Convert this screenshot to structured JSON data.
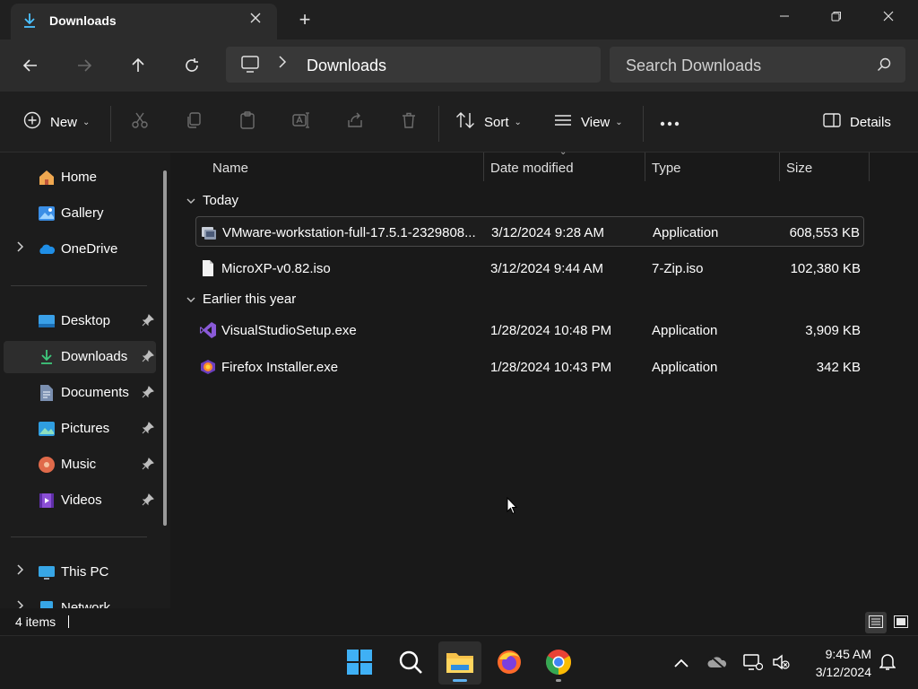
{
  "window": {
    "tab_title": "Downloads",
    "new_tab_symbol": "+"
  },
  "navbar": {
    "breadcrumb": [
      "Downloads"
    ],
    "search_placeholder": "Search Downloads"
  },
  "commandbar": {
    "new_label": "New",
    "sort_label": "Sort",
    "view_label": "View",
    "details_label": "Details"
  },
  "sidebar": {
    "items": [
      {
        "label": "Home",
        "icon": "home-icon"
      },
      {
        "label": "Gallery",
        "icon": "gallery-icon"
      },
      {
        "label": "OneDrive",
        "icon": "onedrive-icon"
      },
      {
        "label": "Desktop",
        "icon": "desktop-icon",
        "pinned": true
      },
      {
        "label": "Downloads",
        "icon": "downloads-icon",
        "pinned": true,
        "active": true
      },
      {
        "label": "Documents",
        "icon": "documents-icon",
        "pinned": true
      },
      {
        "label": "Pictures",
        "icon": "pictures-icon",
        "pinned": true
      },
      {
        "label": "Music",
        "icon": "music-icon",
        "pinned": true
      },
      {
        "label": "Videos",
        "icon": "videos-icon",
        "pinned": true
      },
      {
        "label": "This PC",
        "icon": "this-pc-icon"
      },
      {
        "label": "Network",
        "icon": "network-icon"
      }
    ]
  },
  "content": {
    "columns": [
      "Name",
      "Date modified",
      "Type",
      "Size"
    ],
    "groups": [
      {
        "label": "Today",
        "files": [
          {
            "name": "VMware-workstation-full-17.5.1-2329808...",
            "date": "3/12/2024 9:28 AM",
            "type": "Application",
            "size": "608,553 KB",
            "icon": "vmware-installer-icon",
            "selected": true
          },
          {
            "name": "MicroXP-v0.82.iso",
            "date": "3/12/2024 9:44 AM",
            "type": "7-Zip.iso",
            "size": "102,380 KB",
            "icon": "file-icon"
          }
        ]
      },
      {
        "label": "Earlier this year",
        "files": [
          {
            "name": "VisualStudioSetup.exe",
            "date": "1/28/2024 10:48 PM",
            "type": "Application",
            "size": "3,909 KB",
            "icon": "visual-studio-icon"
          },
          {
            "name": "Firefox Installer.exe",
            "date": "1/28/2024 10:43 PM",
            "type": "Application",
            "size": "342 KB",
            "icon": "firefox-installer-icon"
          }
        ]
      }
    ]
  },
  "status": {
    "item_count": "4 items"
  },
  "taskbar": {
    "time": "9:45 AM",
    "date": "3/12/2024"
  },
  "colors": {
    "accent": "#5fb2f2",
    "background": "#191919",
    "panel": "#2c2c2c"
  }
}
